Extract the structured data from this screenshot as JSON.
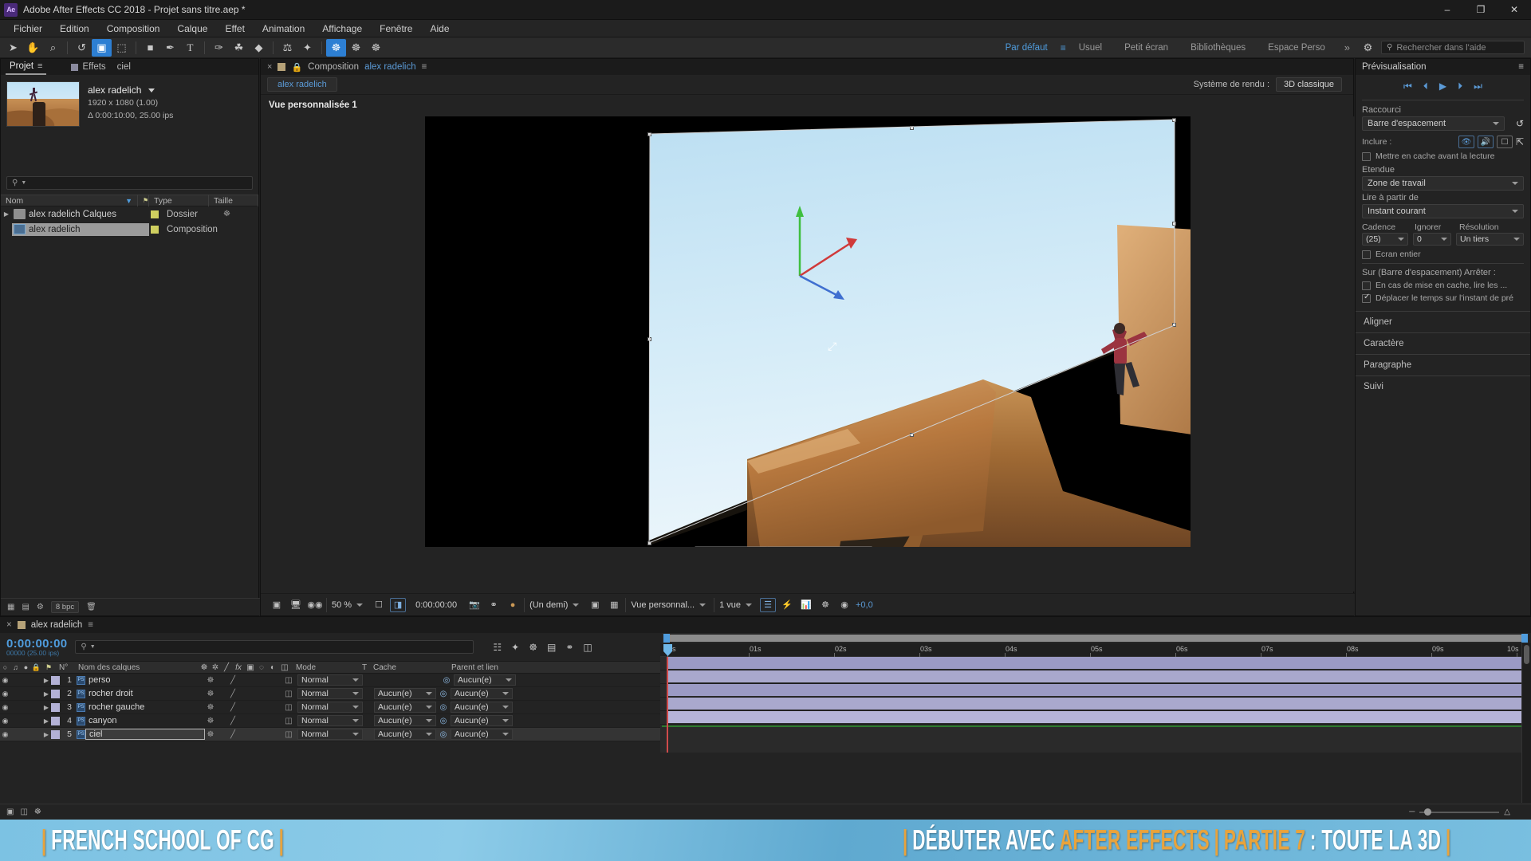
{
  "titlebar": {
    "logo": "Ae",
    "title": "Adobe After Effects CC 2018 - Projet sans titre.aep *",
    "minimize": "–",
    "maximize": "❐",
    "close": "✕"
  },
  "menubar": {
    "items": [
      "Fichier",
      "Edition",
      "Composition",
      "Calque",
      "Effet",
      "Animation",
      "Affichage",
      "Fenêtre",
      "Aide"
    ]
  },
  "toolbar": {
    "tools": [
      {
        "name": "selection-tool",
        "glyph": "➤",
        "active": false
      },
      {
        "name": "hand-tool",
        "glyph": "✋",
        "active": false
      },
      {
        "name": "zoom-tool",
        "glyph": "⌕",
        "active": false
      },
      {
        "name": "rotation-tool",
        "glyph": "↺",
        "active": false
      },
      {
        "name": "unified-camera-tool",
        "glyph": "▣",
        "active": true
      },
      {
        "name": "pan-behind-tool",
        "glyph": "⬚",
        "active": false
      },
      {
        "name": "shape-tool",
        "glyph": "■",
        "active": false
      },
      {
        "name": "pen-tool",
        "glyph": "✒",
        "active": false
      },
      {
        "name": "text-tool",
        "glyph": "T",
        "active": false
      },
      {
        "name": "brush-tool",
        "glyph": "✑",
        "active": false
      },
      {
        "name": "clone-stamp-tool",
        "glyph": "⚘",
        "active": false
      },
      {
        "name": "eraser-tool",
        "glyph": "◆",
        "active": false
      },
      {
        "name": "roto-brush-tool",
        "glyph": "⚒",
        "active": false
      },
      {
        "name": "puppet-pin-tool",
        "glyph": "✦",
        "active": false
      }
    ],
    "right_tools": [
      {
        "name": "puppet-position-tool",
        "glyph": "☸"
      },
      {
        "name": "puppet-starch-tool",
        "glyph": "⚓"
      },
      {
        "name": "puppet-overlap-tool",
        "glyph": "⚙"
      }
    ],
    "workspaces": [
      {
        "label": "Par défaut",
        "selected": true
      },
      {
        "label": "Usuel",
        "selected": false
      },
      {
        "label": "Petit écran",
        "selected": false
      },
      {
        "label": "Bibliothèques",
        "selected": false
      },
      {
        "label": "Espace Perso",
        "selected": false
      }
    ],
    "workspace_more": "»",
    "search_placeholder": "Rechercher dans l'aide"
  },
  "project": {
    "tabs": [
      {
        "label": "Projet",
        "active": true
      },
      {
        "label": "Effets",
        "active": false
      },
      {
        "label": "ciel",
        "active": false
      }
    ],
    "item_name": "alex radelich",
    "dimensions": "1920 x 1080 (1.00)",
    "duration": "Δ 0:00:10:00, 25.00 ips",
    "search_placeholder": "",
    "columns": [
      "Nom",
      "Type",
      "Taille"
    ],
    "rows": [
      {
        "name": "alex radelich Calques",
        "type": "Dossier",
        "selected": false,
        "is_folder": true
      },
      {
        "name": "alex radelich",
        "type": "Composition",
        "selected": true,
        "is_folder": false
      }
    ],
    "footer_bpc": "8 bpc"
  },
  "composition": {
    "tab_close": "×",
    "tab_label": "Composition",
    "tab_name": "alex radelich",
    "chip_label": "alex radelich",
    "render_system_label": "Système de rendu :",
    "render_system_value": "3D classique",
    "view_label": "Vue personnalisée 1",
    "bottom": {
      "zoom": "50 %",
      "timecode": "0:00:00:00",
      "resolution": "(Un demi)",
      "view_layout": "Vue personnal...",
      "views": "1 vue",
      "exposure": "+0,0"
    }
  },
  "preview": {
    "title": "Prévisualisation",
    "transport": [
      "⏮",
      "⏴",
      "▶",
      "⏵",
      "⏭"
    ],
    "shortcut_label": "Raccourci",
    "shortcut_value": "Barre d'espacement",
    "include_label": "Inclure :",
    "cache_checkbox": "Mettre en cache avant la lecture",
    "cache_checked": false,
    "range_label": "Etendue",
    "range_value": "Zone de travail",
    "playfrom_label": "Lire à partir de",
    "playfrom_value": "Instant courant",
    "cadence_label": "Cadence",
    "cadence_value": "(25)",
    "skip_label": "Ignorer",
    "skip_value": "0",
    "resolution_label": "Résolution",
    "resolution_value": "Un tiers",
    "fullscreen_checkbox": "Ecran entier",
    "fullscreen_checked": false,
    "onstop_label": "Sur (Barre d'espacement) Arrêter :",
    "onstop_1": "En cas de mise en cache, lire les ...",
    "onstop_1_checked": false,
    "onstop_2": "Déplacer le temps sur l'instant de pré",
    "onstop_2_checked": true,
    "collapsed_panels": [
      "Aligner",
      "Caractère",
      "Paragraphe",
      "Suivi"
    ]
  },
  "timeline": {
    "tab_name": "alex radelich",
    "timecode": "0:00:00:00",
    "timecode_sub": "00000 (25.00 ips)",
    "search_placeholder": "",
    "columns": {
      "num": "N°",
      "layer_name": "Nom des calques",
      "mode": "Mode",
      "t": "T",
      "matte": "Cache",
      "parent": "Parent et lien"
    },
    "layers": [
      {
        "num": "1",
        "name": "perso",
        "mode": "Normal",
        "matte": "",
        "parent": "Aucun(e)",
        "selected": false,
        "editing": false
      },
      {
        "num": "2",
        "name": "rocher droit",
        "mode": "Normal",
        "matte": "Aucun(e)",
        "parent": "Aucun(e)",
        "selected": false,
        "editing": false
      },
      {
        "num": "3",
        "name": "rocher gauche",
        "mode": "Normal",
        "matte": "Aucun(e)",
        "parent": "Aucun(e)",
        "selected": false,
        "editing": false
      },
      {
        "num": "4",
        "name": "canyon",
        "mode": "Normal",
        "matte": "Aucun(e)",
        "parent": "Aucun(e)",
        "selected": false,
        "editing": false
      },
      {
        "num": "5",
        "name": "ciel",
        "mode": "Normal",
        "matte": "Aucun(e)",
        "parent": "Aucun(e)",
        "selected": true,
        "editing": true
      }
    ],
    "ruler_ticks": [
      "0s",
      "01s",
      "02s",
      "03s",
      "04s",
      "05s",
      "06s",
      "07s",
      "08s",
      "09s",
      "10s"
    ]
  },
  "banner": {
    "left_pipe": "|",
    "left_text": "FRENCH SCHOOL OF CG",
    "right_text_1": "DÉBUTER AVEC",
    "right_text_gold": "AFTER EFFECTS",
    "right_text_gold2": "PARTIE 7",
    "right_text_2": ": TOUTE LA 3D"
  },
  "colors": {
    "accent_blue": "#5b9ad6",
    "banner_blue": "#7cc2e3",
    "banner_gold": "#e8a33c",
    "panel_bg": "#232323"
  }
}
